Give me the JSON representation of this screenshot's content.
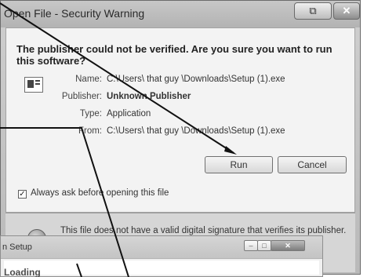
{
  "security_dialog": {
    "title": "Open File - Security Warning",
    "close_glyph": "✕",
    "restore_glyph": "⧉",
    "headline": "The publisher could not be verified.  Are you sure you want to run this software?",
    "fields": {
      "name_label": "Name:",
      "name_value": "C:\\Users\\ that guy \\Downloads\\Setup (1).exe",
      "publisher_label": "Publisher:",
      "publisher_value": "Unknown Publisher",
      "type_label": "Type:",
      "type_value": "Application",
      "from_label": "From:",
      "from_value": "C:\\Users\\ that guy \\Downloads\\Setup (1).exe"
    },
    "run_button": "Run",
    "cancel_button": "Cancel",
    "checkbox": {
      "checked": true,
      "mark": "✓",
      "label": "Always ask before opening this file"
    },
    "footer_text": "This file does not have a valid digital signature that verifies its publisher. You should only run software from publishers you trust."
  },
  "setup_window": {
    "title": "n Setup",
    "min_glyph": "–",
    "max_glyph": "□",
    "close_glyph": "✕",
    "logo_text": "Loading"
  },
  "colors": {
    "pointer": "#111111"
  }
}
